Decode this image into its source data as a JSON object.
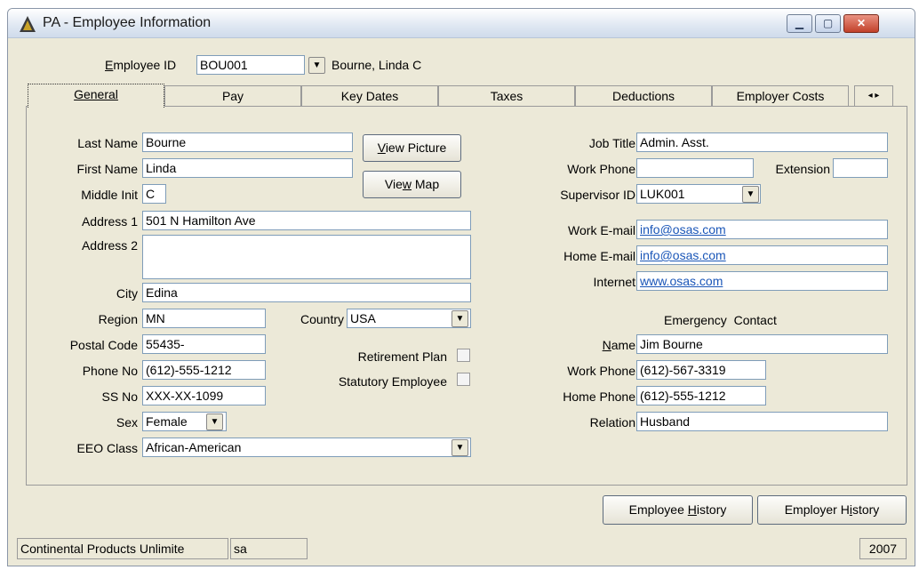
{
  "window": {
    "title": "PA - Employee Information"
  },
  "header": {
    "employee_id_label": "Employee ID",
    "employee_id_value": "BOU001",
    "employee_name": "Bourne, Linda C"
  },
  "tabs": [
    {
      "label": "General"
    },
    {
      "label": "Pay"
    },
    {
      "label": "Key Dates"
    },
    {
      "label": "Taxes"
    },
    {
      "label": "Deductions"
    },
    {
      "label": "Employer Costs"
    }
  ],
  "left": {
    "last_name": {
      "label": "Last Name",
      "value": "Bourne"
    },
    "first_name": {
      "label": "First Name",
      "value": "Linda"
    },
    "middle_init": {
      "label": "Middle Init",
      "value": "C"
    },
    "address1": {
      "label": "Address 1",
      "value": "501 N Hamilton Ave"
    },
    "address2": {
      "label": "Address 2",
      "value": ""
    },
    "city": {
      "label": "City",
      "value": "Edina"
    },
    "region": {
      "label": "Region",
      "value": "MN"
    },
    "country": {
      "label": "Country",
      "value": "USA"
    },
    "postal_code": {
      "label": "Postal Code",
      "value": "55435-"
    },
    "phone_no": {
      "label": "Phone No",
      "value": "(612)-555-1212"
    },
    "ss_no": {
      "label": "SS No",
      "value": "XXX-XX-1099"
    },
    "sex": {
      "label": "Sex",
      "value": "Female"
    },
    "eeo_class": {
      "label": "EEO Class",
      "value": "African-American"
    },
    "retirement_plan_label": "Retirement Plan",
    "statutory_employee_label": "Statutory Employee",
    "view_picture_label": "View Picture",
    "view_map_label": "View Map"
  },
  "right": {
    "job_title": {
      "label": "Job Title",
      "value": "Admin. Asst."
    },
    "work_phone": {
      "label": "Work Phone",
      "value": ""
    },
    "extension": {
      "label": "Extension",
      "value": ""
    },
    "supervisor_id": {
      "label": "Supervisor ID",
      "value": "LUK001"
    },
    "work_email": {
      "label": "Work E-mail",
      "value": "info@osas.com"
    },
    "home_email": {
      "label": "Home E-mail",
      "value": "info@osas.com"
    },
    "internet": {
      "label": "Internet",
      "value": "www.osas.com"
    },
    "emergency_heading": "Emergency  Contact",
    "ec_name": {
      "label": "Name",
      "value": "Jim Bourne"
    },
    "ec_work_phone": {
      "label": "Work Phone",
      "value": "(612)-567-3319"
    },
    "ec_home_phone": {
      "label": "Home Phone",
      "value": "(612)-555-1212"
    },
    "ec_relation": {
      "label": "Relation",
      "value": "Husband"
    }
  },
  "footer": {
    "employee_history_label": "Employee History",
    "employer_history_label": "Employer History"
  },
  "status": {
    "company": "Continental Products Unlimite",
    "user": "sa",
    "year": "2007"
  }
}
